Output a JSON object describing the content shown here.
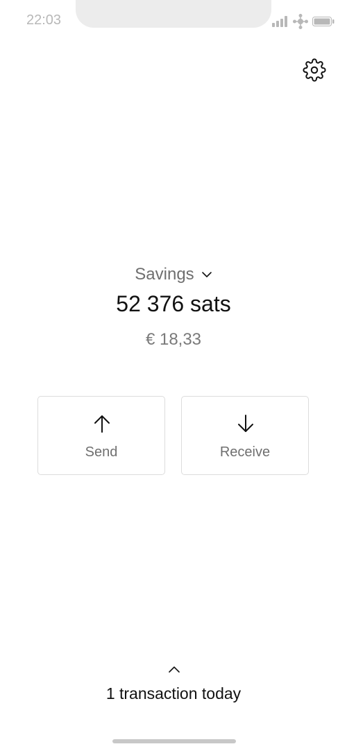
{
  "status_bar": {
    "time": "22:03",
    "icons": [
      "signal-icon",
      "wifi-icon",
      "battery-icon"
    ]
  },
  "header": {
    "settings_icon": "gear-icon"
  },
  "wallet": {
    "name": "Savings",
    "balance": "52 376 sats",
    "fiat_balance": "€ 18,33"
  },
  "actions": {
    "send_label": "Send",
    "receive_label": "Receive"
  },
  "transactions": {
    "summary": "1 transaction today"
  },
  "colors": {
    "primary_text": "#111111",
    "secondary_text": "#6f6f6f",
    "border": "#dcdcdc",
    "status_gray": "#b8b8b8"
  }
}
